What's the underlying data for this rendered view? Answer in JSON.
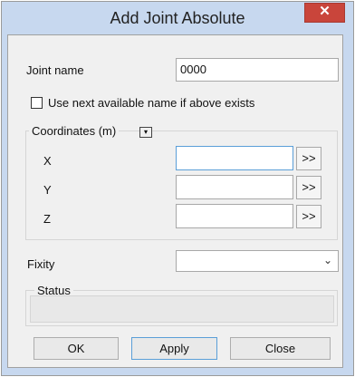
{
  "window": {
    "title": "Add Joint Absolute",
    "close_glyph": "✕"
  },
  "joint_name": {
    "label": "Joint name",
    "value": "0000"
  },
  "use_next": {
    "label": "Use next available name if above exists",
    "checked": false
  },
  "coordinates": {
    "legend": "Coordinates (m)",
    "dropdown_glyph": "▾",
    "rows": [
      {
        "axis": "X",
        "value": "",
        "button": ">>"
      },
      {
        "axis": "Y",
        "value": "",
        "button": ">>"
      },
      {
        "axis": "Z",
        "value": "",
        "button": ">>"
      }
    ]
  },
  "fixity": {
    "label": "Fixity",
    "value": "",
    "chevron": "⌄"
  },
  "status": {
    "legend": "Status",
    "text": ""
  },
  "buttons": {
    "ok": "OK",
    "apply": "Apply",
    "close": "Close"
  }
}
